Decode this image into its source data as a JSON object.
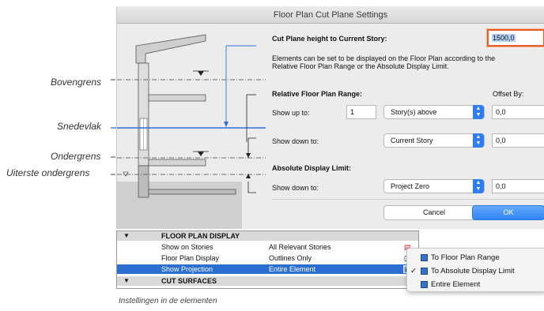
{
  "annotations": {
    "upper_limit": "Bovengrens",
    "cut_plane": "Snedevlak",
    "lower_limit": "Ondergrens",
    "absolute_lower_limit": "Uiterste ondergrens"
  },
  "dialog": {
    "title": "Floor Plan Cut Plane Settings",
    "cut_plane_height_label": "Cut Plane height to Current Story:",
    "cut_plane_height_value": "1500,0",
    "description_line1": "Elements can be set to be displayed on the Floor Plan according to the",
    "description_line2": "Relative Floor Plan Range or the Absolute Display Limit.",
    "relative_range_heading": "Relative Floor Plan Range:",
    "offset_by_label": "Offset By:",
    "show_up_to_label": "Show up to:",
    "show_up_to_count": "1",
    "show_up_to_select": "Story(s) above",
    "show_up_to_offset": "0,0",
    "show_down_to_label": "Show down to:",
    "show_down_to_select": "Current Story",
    "show_down_to_offset": "0,0",
    "absolute_limit_heading": "Absolute Display Limit:",
    "abs_show_down_to_label": "Show down to:",
    "abs_show_down_to_select": "Project Zero",
    "abs_show_down_to_offset": "0,0",
    "cancel_label": "Cancel",
    "ok_label": "OK"
  },
  "settings_panel": {
    "section1_title": "FLOOR PLAN DISPLAY",
    "rows": [
      {
        "label": "Show on Stories",
        "value": "All Relevant Stories",
        "icon": "stories-icon"
      },
      {
        "label": "Floor Plan Display",
        "value": "Outlines Only",
        "icon": "outline-box-icon"
      },
      {
        "label": "Show Projection",
        "value": "Entire Element",
        "icon": "projection-icon"
      }
    ],
    "section2_title": "CUT SURFACES"
  },
  "popup_menu": {
    "items": [
      {
        "label": "To Floor Plan Range",
        "checked": false
      },
      {
        "label": "To Absolute Display Limit",
        "checked": true
      },
      {
        "label": "Entire Element",
        "checked": false
      }
    ],
    "check_glyph": "✓"
  },
  "caption": "Instellingen in de elementen",
  "colors": {
    "accent_blue": "#2e7cf6",
    "cut_plane_line": "#2f6fe0",
    "highlight_border": "#e65c2a",
    "selected_row": "#2a6ed2"
  }
}
